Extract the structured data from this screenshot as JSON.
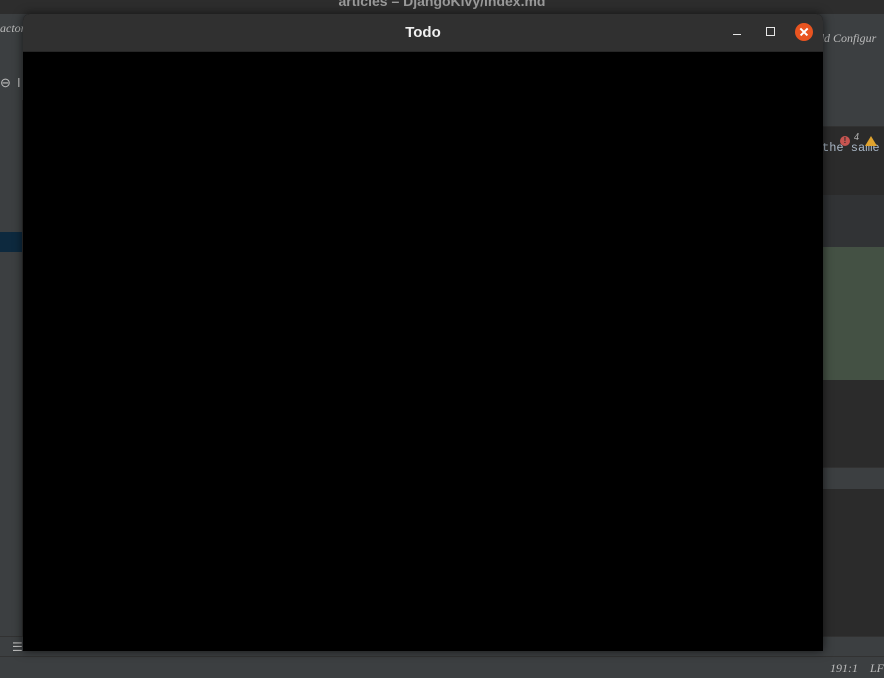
{
  "ide": {
    "window_title": "articles – DjangoKivy/index.md",
    "menu_left_fragment": "actor",
    "run_config_fragment": "dd Configur",
    "code_fragment": "the same",
    "inspections": {
      "error_count": "4",
      "error_color": "#c75450",
      "warning_color": "#e0a32e"
    },
    "status": {
      "caret_position": "191:1",
      "line_separator_fragment": "LF"
    },
    "colors": {
      "background": "#3c3f41",
      "editor": "#2b2b2b",
      "selection": "#0d293e",
      "diff_added": "#445144"
    }
  },
  "todo_window": {
    "title": "Todo",
    "buttons": {
      "minimize_icon": "minimize-icon",
      "maximize_icon": "maximize-icon",
      "close_icon": "close-icon",
      "close_color": "#e95420"
    },
    "canvas_color": "#000000"
  }
}
